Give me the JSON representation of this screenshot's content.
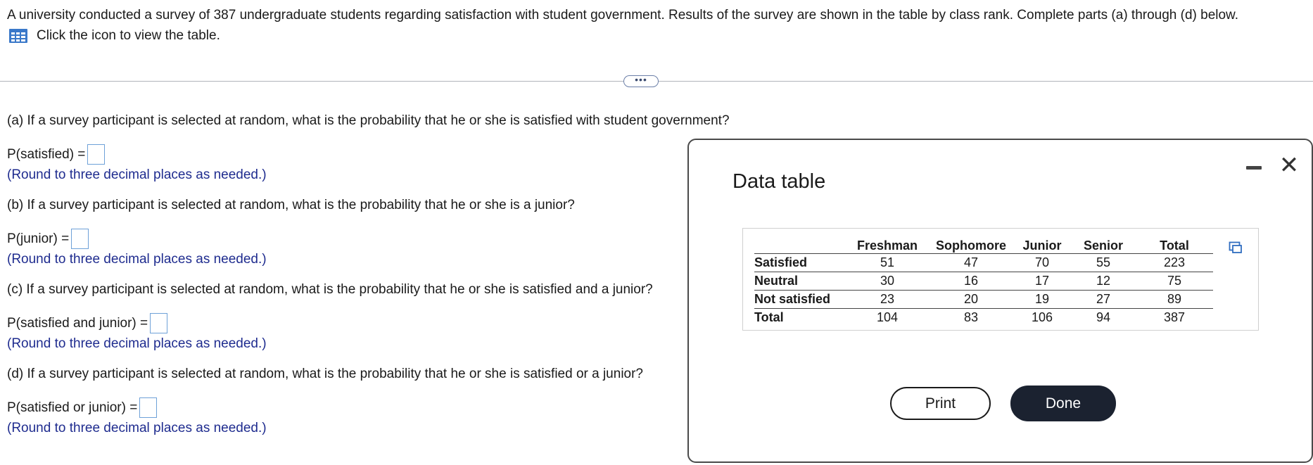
{
  "intro": "A university conducted a survey of 387 undergraduate students regarding satisfaction with student government. Results of the survey are shown in the table by class rank. Complete parts (a) through (d) below.",
  "table_link": {
    "icon": "grid-table-icon",
    "text": "Click the icon to view the table."
  },
  "expander_label": "•••",
  "questions": [
    {
      "prompt": "(a) If a survey participant is selected at random, what is the probability that he or she is satisfied with student government?",
      "answer_label": "P(satisfied) =",
      "hint": "(Round to three decimal places as needed.)"
    },
    {
      "prompt": "(b) If a survey participant is selected at random, what is the probability that he or she is a junior?",
      "answer_label": "P(junior) =",
      "hint": "(Round to three decimal places as needed.)"
    },
    {
      "prompt": "(c) If a survey participant is selected at random, what is the probability that he or she is satisfied and a junior?",
      "answer_label": "P(satisfied and junior) =",
      "hint": "(Round to three decimal places as needed.)"
    },
    {
      "prompt": "(d) If a survey participant is selected at random, what is the probability that he or she is satisfied or a junior?",
      "answer_label": "P(satisfied or junior) =",
      "hint": "(Round to three decimal places as needed.)"
    }
  ],
  "dialog": {
    "title": "Data table",
    "columns": [
      "",
      "Freshman",
      "Sophomore",
      "Junior",
      "Senior",
      "Total"
    ],
    "rows": [
      {
        "label": "Satisfied",
        "values": [
          "51",
          "47",
          "70",
          "55",
          "223"
        ]
      },
      {
        "label": "Neutral",
        "values": [
          "30",
          "16",
          "17",
          "12",
          "75"
        ]
      },
      {
        "label": "Not satisfied",
        "values": [
          "23",
          "20",
          "19",
          "27",
          "89"
        ]
      },
      {
        "label": "Total",
        "values": [
          "104",
          "83",
          "106",
          "94",
          "387"
        ]
      }
    ],
    "print_label": "Print",
    "done_label": "Done",
    "close_glyph": "✕"
  },
  "colors": {
    "hint": "#1f2c8f",
    "input_border": "#6ea1d8",
    "done_bg": "#1b2230"
  }
}
